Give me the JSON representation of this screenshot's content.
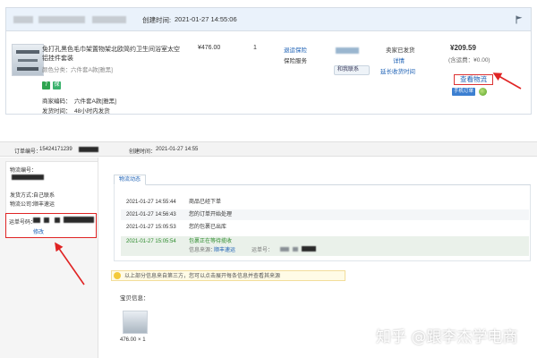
{
  "top": {
    "created_label": "创建时间:",
    "created_time": "2021-01-27 14:55:06",
    "product_title_line1": "免打孔黑色毛巾架置物架北欧简约卫生间浴室太空",
    "product_title_line2": "铝挂件套装",
    "color_label": "颜色分类：",
    "color_value": "六件套A款[雅黑]",
    "unit_price": "¥476.00",
    "quantity": "1",
    "refund_link": "退运保险",
    "guarantee_service": "保险服务",
    "contact_seller": "和我联系",
    "status": "卖家已发货",
    "details": "详情",
    "extend_receipt": "延长收货时间",
    "total_price": "¥209.59",
    "shipping_note": "(含运费：¥0.00)",
    "view_logistics": "查看物流",
    "mobile_order": "手机订单",
    "badge_7": "7",
    "badge_bao": "保",
    "merchant_code_label": "商家编码：",
    "merchant_code_value": "六件套A款[雅黑]",
    "ship_time_label": "发货时间：",
    "ship_time_value": "48小时内发货"
  },
  "bottom": {
    "order_no_label": "订单编号：",
    "order_no_value": "15424171239",
    "created_label": "创建时间：",
    "created_time": "2021-01-27 14:55",
    "logistics_no_label": "物流编号：",
    "ship_method_label": "发货方式：",
    "ship_method_value": "自己联系",
    "logistics_co_label": "物流公司：",
    "logistics_co_value": "顺丰速运",
    "waybill_label": "运单号码：",
    "waybill_action": "修改",
    "tab_logistics": "物流动态",
    "tracking": [
      {
        "time": "2021-01-27 14:55:44",
        "desc": "商品已经下单"
      },
      {
        "time": "2021-01-27 14:56:43",
        "desc": "您的订单开始处理"
      },
      {
        "time": "2021-01-27 15:05:53",
        "desc": "您的包裹已出库"
      },
      {
        "time": "2021-01-27 15:05:54",
        "desc": "包裹正在等待揽收"
      }
    ],
    "info_source_label": "信息来源：",
    "info_source_value": "顺丰速运",
    "waybill_short_label": "运单号：",
    "notice_text": "以上部分信息来自第三方，您可以点击展开每条信息并查看其来源",
    "goods_info_label": "宝贝信息：",
    "goods_price_qty": "476.00 × 1"
  },
  "watermark": "知乎 @跟李杰学电商",
  "colors": {
    "accent_blue": "#1a5fb4",
    "highlight_red": "#e02424",
    "header_bg": "#eaf2fb",
    "track_green": "#2a8a2a"
  }
}
